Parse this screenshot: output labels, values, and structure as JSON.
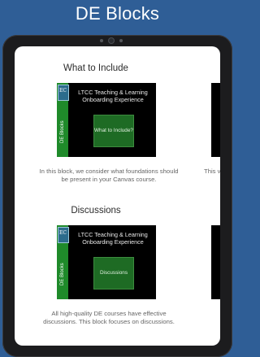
{
  "page": {
    "title": "DE Blocks"
  },
  "blocks": [
    {
      "heading": "What to Include",
      "thumbnail": {
        "strip_label": "DE Blocks",
        "logo_text": "EC",
        "title": "LTCC Teaching & Learning Onboarding Experience",
        "button": "What to Include?"
      },
      "description": "In this block, we consider what foundations should be present in your Canvas course."
    },
    {
      "heading": "Discussions",
      "thumbnail": {
        "strip_label": "DE Blocks",
        "logo_text": "EC",
        "title": "LTCC Teaching & Learning Onboarding Experience",
        "button": "Discussions"
      },
      "description": "All high-quality DE courses have effective discussions. This block focuses on discussions."
    }
  ],
  "peek": {
    "text": "This v"
  },
  "colors": {
    "background": "#2f5e96",
    "accent_green": "#1f8a2a",
    "slide_bg": "#000000"
  }
}
